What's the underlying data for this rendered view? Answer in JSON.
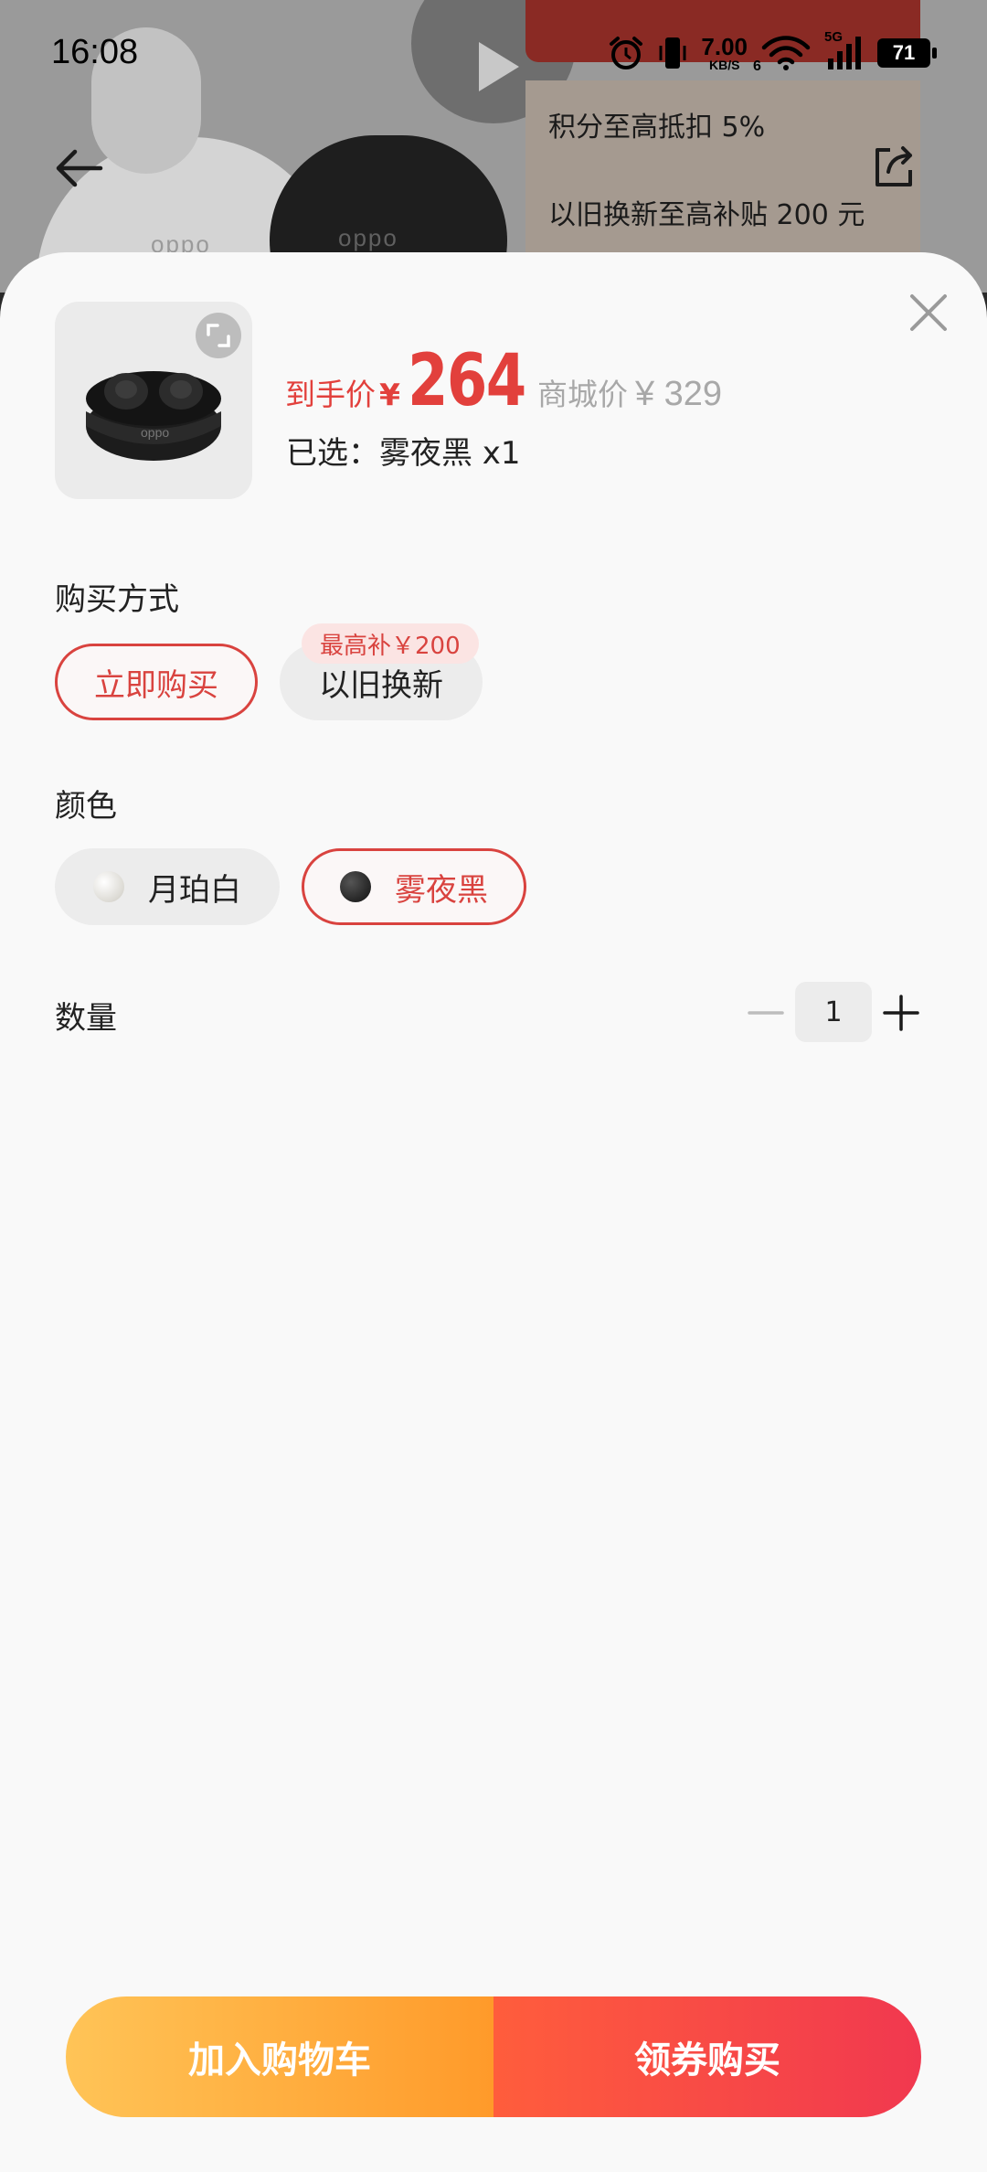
{
  "status_bar": {
    "time": "16:08",
    "net_speed_value": "7.00",
    "net_speed_unit": "KB/S",
    "network_type": "5G",
    "sim_slot": "6",
    "battery_level": "71"
  },
  "background": {
    "case_white_logo": "oppo",
    "case_black_logo": "oppo",
    "promo_lines": [
      "积分至高抵扣 5%",
      "以旧换新至高补贴 200 元"
    ]
  },
  "product": {
    "final_price_label": "到手价",
    "currency": "¥",
    "final_price": "264",
    "mall_price_label": "商城价",
    "mall_price": "¥ 329",
    "selected_label": "已选：雾夜黑 x1"
  },
  "purchase_method": {
    "title": "购买方式",
    "options": [
      "立即购买",
      "以旧换新"
    ],
    "selected_index": 0,
    "subsidy_badge": "最高补￥200"
  },
  "color": {
    "title": "颜色",
    "options": [
      {
        "label": "月珀白",
        "swatch": "#e6e4df"
      },
      {
        "label": "雾夜黑",
        "swatch": "#2b2b2b"
      }
    ],
    "selected_index": 1
  },
  "quantity": {
    "title": "数量",
    "value": "1"
  },
  "actions": {
    "add_to_cart": "加入购物车",
    "buy_with_coupon": "领券购买"
  },
  "colors": {
    "accent_red": "#e2403c",
    "cart_gradient": [
      "#ffc457",
      "#ff9a2a"
    ],
    "buy_gradient": [
      "#ff5d3c",
      "#f1384f"
    ]
  }
}
